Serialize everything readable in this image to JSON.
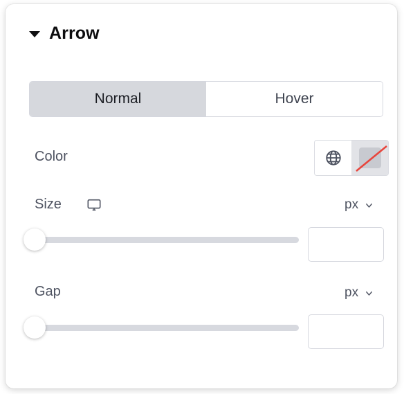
{
  "panel": {
    "title": "Arrow",
    "collapse_icon": "caret-down-icon"
  },
  "tabs": [
    {
      "label": "Normal",
      "active": true
    },
    {
      "label": "Hover",
      "active": false
    }
  ],
  "controls": {
    "color": {
      "label": "Color",
      "global_icon": "globe-icon",
      "swatch_value": "",
      "swatch_state": "empty",
      "swatch_slash_color": "#e8453c"
    },
    "size": {
      "label": "Size",
      "device_icon": "desktop-icon",
      "unit": "px",
      "unit_chevron": "chevron-down-icon",
      "slider_value": 0,
      "input_value": "",
      "input_placeholder": ""
    },
    "gap": {
      "label": "Gap",
      "unit": "px",
      "unit_chevron": "chevron-down-icon",
      "slider_value": 0,
      "input_value": "",
      "input_placeholder": ""
    }
  },
  "colors": {
    "label_text": "#4d5260",
    "title_text": "#0d0d0f",
    "tab_active_bg": "#d6d8dd",
    "track": "#d7d9df",
    "border": "#d5d7de"
  }
}
